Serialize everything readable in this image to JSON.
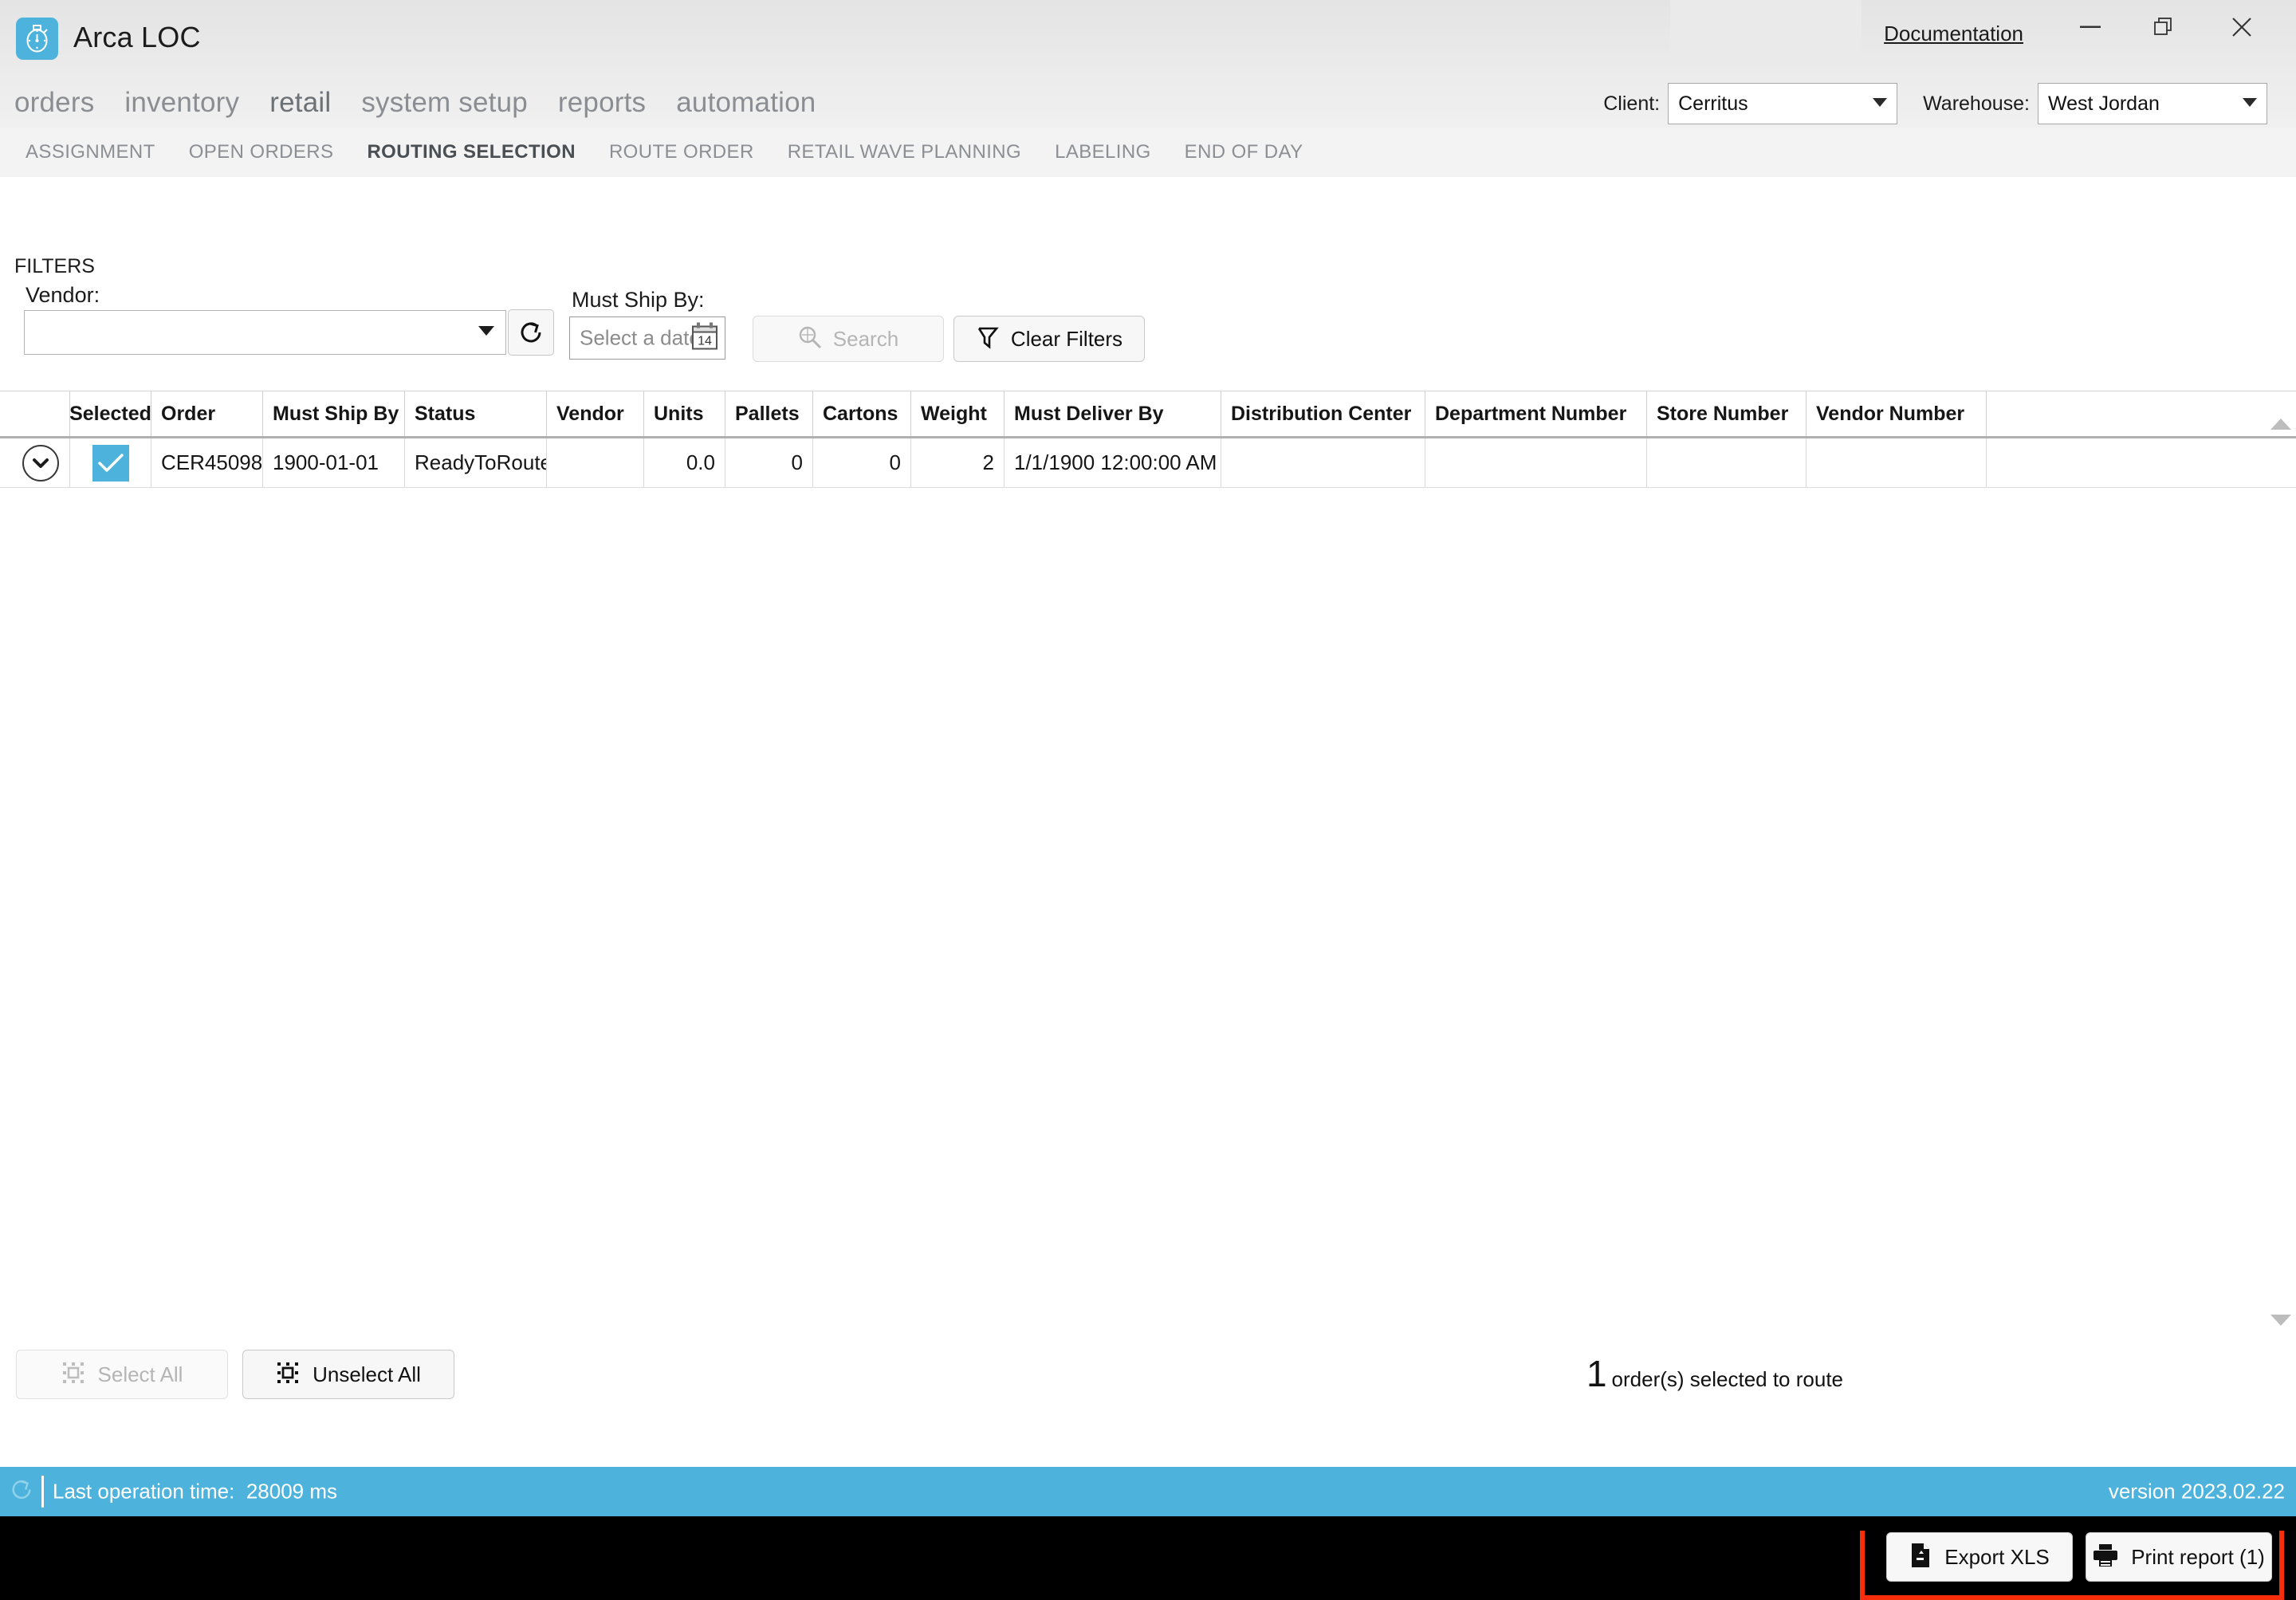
{
  "window": {
    "app_title": "Arca LOC",
    "documentation_link": "Documentation",
    "controls": {
      "minimize": "minimize-icon",
      "maximize": "restore-icon",
      "close": "close-icon"
    }
  },
  "main_nav": {
    "items": [
      {
        "label": "orders",
        "active": false
      },
      {
        "label": "inventory",
        "active": false
      },
      {
        "label": "retail",
        "active": true
      },
      {
        "label": "system setup",
        "active": false
      },
      {
        "label": "reports",
        "active": false
      },
      {
        "label": "automation",
        "active": false
      }
    ]
  },
  "context_selectors": {
    "client_label": "Client:",
    "client_value": "Cerritus",
    "warehouse_label": "Warehouse:",
    "warehouse_value": "West Jordan"
  },
  "sub_nav": {
    "items": [
      {
        "label": "ASSIGNMENT",
        "active": false
      },
      {
        "label": "OPEN ORDERS",
        "active": false
      },
      {
        "label": "ROUTING SELECTION",
        "active": true
      },
      {
        "label": "ROUTE ORDER",
        "active": false
      },
      {
        "label": "RETAIL WAVE PLANNING",
        "active": false
      },
      {
        "label": "LABELING",
        "active": false
      },
      {
        "label": "END OF DAY",
        "active": false
      }
    ]
  },
  "filters": {
    "heading": "FILTERS",
    "vendor_label": "Vendor:",
    "vendor_value": "",
    "refresh_icon": "refresh-icon",
    "must_ship_by_label": "Must Ship By:",
    "date_placeholder": "Select a date",
    "date_value": "",
    "calendar_icon_day": "14",
    "search_label": "Search",
    "search_enabled": false,
    "clear_filters_label": "Clear Filters"
  },
  "table": {
    "columns": [
      "Selected",
      "Order",
      "Must Ship By",
      "Status",
      "Vendor",
      "Units",
      "Pallets",
      "Cartons",
      "Weight",
      "Must Deliver By",
      "Distribution Center",
      "Department Number",
      "Store Number",
      "Vendor Number"
    ],
    "rows": [
      {
        "selected": true,
        "order": "CER45098",
        "must_ship_by": "1900-01-01",
        "status": "ReadyToRoute",
        "vendor": "",
        "units": "0.0",
        "pallets": "0",
        "cartons": "0",
        "weight": "2",
        "must_deliver_by": "1/1/1900 12:00:00 AM",
        "distribution_center": "",
        "department_number": "",
        "store_number": "",
        "vendor_number": ""
      }
    ]
  },
  "footer": {
    "select_all_label": "Select All",
    "select_all_enabled": false,
    "unselect_all_label": "Unselect All",
    "unselect_all_enabled": true,
    "selected_count": "1",
    "selected_text": "order(s) selected to route",
    "export_label": "Export XLS",
    "print_label": "Print report (1)",
    "highlight_color": "#f82e0a"
  },
  "status_bar": {
    "refresh_icon": "refresh-icon",
    "operation_label": "Last operation time:",
    "operation_value": "28009 ms",
    "version": "version 2023.02.22",
    "background_color": "#4eb3dc"
  },
  "theme": {
    "accent": "#4eb3dc",
    "chrome": "#e9e9e9",
    "highlight": "#f82e0a"
  }
}
